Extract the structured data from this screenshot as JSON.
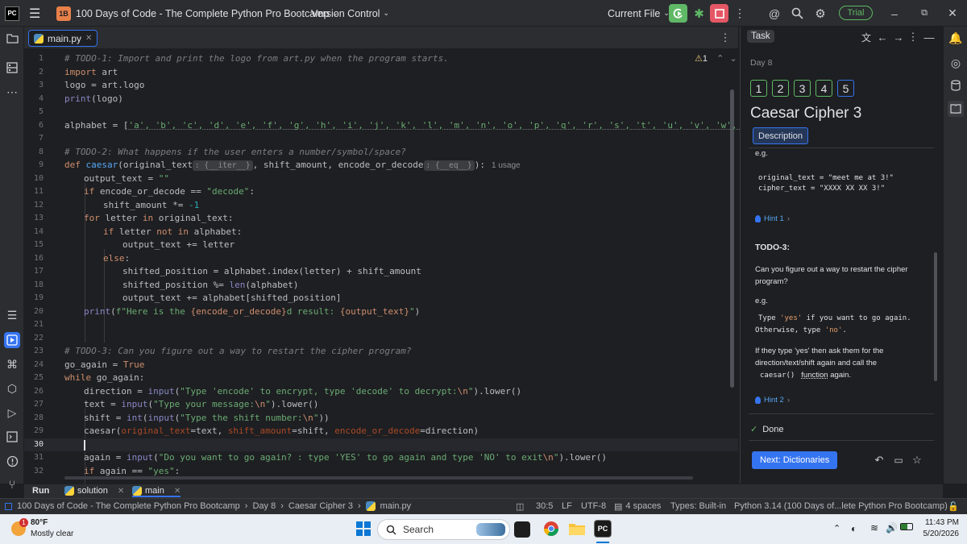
{
  "window": {
    "logo": "PC",
    "project_badge": "1B",
    "project_name": "100 Days of Code - The Complete Python Pro Bootcamp",
    "vcs": "Version Control",
    "run_config": "Current File",
    "trial": "Trial"
  },
  "editor": {
    "tab_label": "main.py",
    "warning_count": "1",
    "lines": [
      {
        "n": "1"
      },
      {
        "n": "2"
      },
      {
        "n": "3"
      },
      {
        "n": "4"
      },
      {
        "n": "5"
      },
      {
        "n": "6"
      },
      {
        "n": "7"
      },
      {
        "n": "8"
      },
      {
        "n": "9"
      },
      {
        "n": "10"
      },
      {
        "n": "11"
      },
      {
        "n": "12"
      },
      {
        "n": "13"
      },
      {
        "n": "14"
      },
      {
        "n": "15"
      },
      {
        "n": "16"
      },
      {
        "n": "17"
      },
      {
        "n": "18"
      },
      {
        "n": "19"
      },
      {
        "n": "20"
      },
      {
        "n": "21"
      },
      {
        "n": "22"
      },
      {
        "n": "23"
      },
      {
        "n": "24"
      },
      {
        "n": "25"
      },
      {
        "n": "26"
      },
      {
        "n": "27"
      },
      {
        "n": "28"
      },
      {
        "n": "29"
      },
      {
        "n": "30"
      },
      {
        "n": "31"
      },
      {
        "n": "32"
      }
    ],
    "code": {
      "l1": "# TODO-1: Import and print the logo from art.py when the program starts.",
      "l2a": "import",
      "l2b": " art",
      "l3": "logo = art.logo",
      "l4a": "print",
      "l4b": "(logo)",
      "l6a": "alphabet = [",
      "l6b": "'a', 'b', 'c', 'd', 'e', 'f', 'g', 'h', 'i', 'j', 'k', 'l', 'm', 'n', 'o', 'p', 'q', 'r', 's', 't', 'u', 'v', 'w', 'x', 'y', 'z",
      "l8": "# TODO-2: What happens if the user enters a number/symbol/space?",
      "l9a": "def",
      "l9b": "caesar",
      "l9c": "(original_text",
      "l9h1": ": {__iter__}",
      "l9d": ", shift_amount, encode_or_decode",
      "l9h2": ": {__eq__}",
      "l9e": "):",
      "l9u": "1 usage",
      "l10a": "output_text = ",
      "l10b": "\"\"",
      "l11a": "if",
      "l11b": " encode_or_decode == ",
      "l11c": "\"decode\"",
      "l11d": ":",
      "l12a": "shift_amount *= ",
      "l12b": "-1",
      "l13a": "for",
      "l13b": " letter ",
      "l13c": "in",
      "l13d": " original_text:",
      "l14a": "if",
      "l14b": " letter ",
      "l14c": "not in",
      "l14d": " alphabet:",
      "l15": "output_text += letter",
      "l16a": "else",
      "l16b": ":",
      "l17": "shifted_position = alphabet.index(letter) + shift_amount",
      "l18a": "shifted_position %= ",
      "l18b": "len",
      "l18c": "(alphabet)",
      "l19": "output_text += alphabet[shifted_position]",
      "l20a": "print",
      "l20b": "(",
      "l20c": "f\"Here is the ",
      "l20d": "{encode_or_decode}",
      "l20e": "d result: ",
      "l20f": "{output_text}",
      "l20g": "\"",
      "l20h": ")",
      "l23": "# TODO-3: Can you figure out a way to restart the cipher program?",
      "l24a": "go_again = ",
      "l24b": "True",
      "l25a": "while",
      "l25b": " go_again:",
      "l26a": "direction = ",
      "l26b": "input",
      "l26c": "(",
      "l26d": "\"Type 'encode' to encrypt, type 'decode' to decrypt:",
      "l26e": "\\n",
      "l26f": "\"",
      "l26g": ").lower()",
      "l27a": "text = ",
      "l27b": "input",
      "l27c": "(",
      "l27d": "\"Type your message:",
      "l27e": "\\n",
      "l27f": "\"",
      "l27g": ").lower()",
      "l28a": "shift = ",
      "l28b": "int",
      "l28c": "(",
      "l28d": "input",
      "l28e": "(",
      "l28f": "\"Type the shift number:",
      "l28g": "\\n",
      "l28h": "\"",
      "l28i": "))",
      "l29a": "caesar(",
      "l29b": "original_text",
      "l29c": "=text, ",
      "l29d": "shift_amount",
      "l29e": "=shift, ",
      "l29f": "encode_or_decode",
      "l29g": "=direction)",
      "l31a": "again = ",
      "l31b": "input",
      "l31c": "(",
      "l31d": "\"Do you want to go again? : type 'YES' to go again and type 'NO' to exit",
      "l31e": "\\n",
      "l31f": "\"",
      "l31g": ").lower()",
      "l32a": "if",
      "l32b": " again == ",
      "l32c": "\"yes\"",
      "l32d": ":"
    }
  },
  "task": {
    "tab": "Task",
    "day": "Day 8",
    "steps": [
      "1",
      "2",
      "3",
      "4",
      "5"
    ],
    "title": "Caesar Cipher 3",
    "description_tab": "Description",
    "eg1": "e.g.",
    "code1a": "original_text = \"meet me at 3!\"",
    "code1b": "cipher_text = \"XXXX XX XX 3!\"",
    "hint1": "Hint 1",
    "todo3_title": "TODO-3:",
    "todo3_q1": "Can you figure out a way to restart the cipher",
    "todo3_q2": "program?",
    "eg2": "e.g.",
    "type_a": "Type ",
    "type_b": "'yes'",
    "type_c": " if you want to go again.",
    "otherwise_a": "Otherwise, type ",
    "otherwise_b": "'no'",
    "otherwise_c": ".",
    "if_line1": "If they type 'yes' then ask them for the",
    "if_line2": "direction/text/shift again and call the",
    "if_line3a": "caesar()",
    "if_line3b": "function",
    "if_line3c": " again.",
    "hint2": "Hint 2",
    "done": "Done",
    "next_button": "Next: Dictionaries"
  },
  "run_panel": {
    "run": "Run",
    "tab1": "solution",
    "tab2": "main"
  },
  "status": {
    "breadcrumb": [
      "100 Days of Code - The Complete Python Pro Bootcamp",
      "Day 8",
      "Caesar Cipher 3",
      "main.py"
    ],
    "position": "30:5",
    "line_sep": "LF",
    "encoding": "UTF-8",
    "indent": "4 spaces",
    "types": "Types: Built-in",
    "interpreter": "Python 3.14 (100 Days of...lete Python Pro Bootcamp)"
  },
  "taskbar": {
    "weather_temp": "80°F",
    "weather_desc": "Mostly clear",
    "weather_badge": "1",
    "search_placeholder": "Search",
    "time": "11:43 PM",
    "date": "5/20/2026"
  },
  "colors": {
    "accent": "#3574f0",
    "done_green": "#5fb865",
    "background": "#1e1f22",
    "panel": "#2b2d30"
  }
}
